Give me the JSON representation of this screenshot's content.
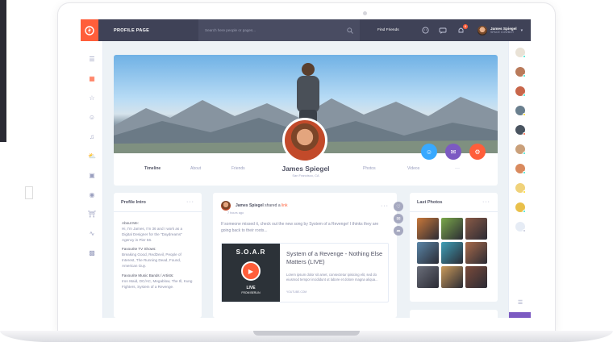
{
  "topbar": {
    "page_title": "PROFILE PAGE",
    "search_placeholder": "Search here people or pages...",
    "find_friends": "Find Friends",
    "notification_count": "8",
    "user_name": "James Spiegel",
    "user_status": "SPACE COWBOY"
  },
  "profile": {
    "name": "James Spiegel",
    "location": "San Francisco, CA",
    "tabs": [
      "Timeline",
      "About",
      "Friends",
      "Photos",
      "Videos",
      "···"
    ]
  },
  "intro": {
    "title": "Profile Intro",
    "about_label": "About Me:",
    "about_text": "Hi, I'm James, I'm 36 and I work as a Digital Designer for the \"Daydreams\" Agency in Pier 56.",
    "tv_label": "Favourite TV Shows:",
    "tv_text": "Breaking Good, RedDevil, People of Interest, The Running Dead, Found, American Guy.",
    "music_label": "Favourite Music Bands / Artists:",
    "music_text": "Iron Maid, DC/AC, Megablow, The Ill, Kung Fighters, System of a Revenge."
  },
  "post": {
    "author": "James Spiegel",
    "action": "shared a",
    "link_word": "link",
    "time": "7 hours ago",
    "text": "If someone missed it, check out the new song by System of a Revenge! I thinks they are going back to their roots...",
    "video": {
      "thumb_title": "S.O.A.R",
      "thumb_live": "LIVE",
      "thumb_city": "FROM BERLIN",
      "title": "System of a Revenge - Nothing Else Matters (LIVE)",
      "desc": "Lorem ipsum dolor sit amet, consectetur ipisicing elit, sed do eiusmod tempor incididunt ut labore et dolore magna aliqua...",
      "source": "YOUTUBE.COM"
    }
  },
  "photos": {
    "title": "Last Photos",
    "colors": [
      "#c9783a",
      "#7aa84a",
      "#8a5a46",
      "#5a86a8",
      "#3fa0b8",
      "#a86a4a",
      "#6a6e7a",
      "#c99a5a",
      "#7a4a3a"
    ]
  },
  "colors": {
    "accent": "#ff5e3a",
    "nav_bg": "#3f4257",
    "blue_btn": "#38a9ff",
    "purple_btn": "#7c5ac2"
  }
}
